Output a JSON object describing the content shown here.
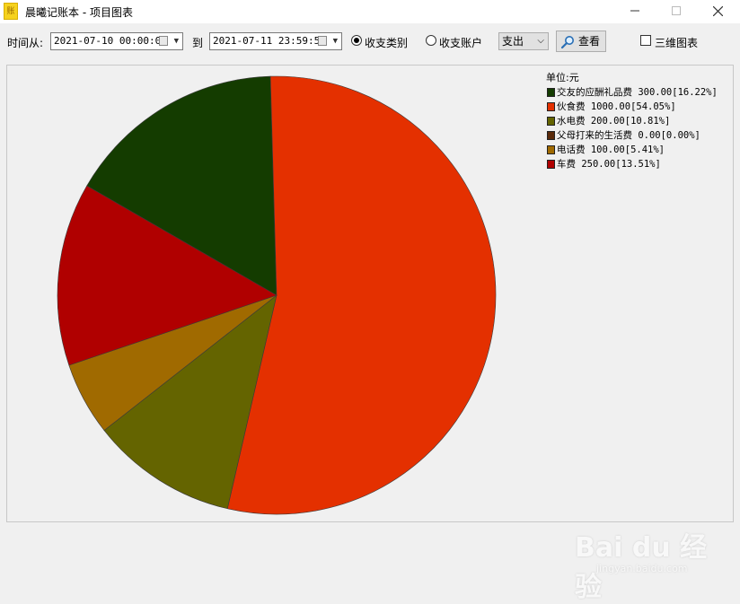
{
  "window": {
    "title": "晨曦记账本 - 项目图表",
    "icon_name": "ledger-app-icon",
    "icon_text": "账"
  },
  "toolbar": {
    "time_from_label": "时间从:",
    "start_datetime": "2021-07-10 00:00:00",
    "to_label": "到",
    "end_datetime": "2021-07-11 23:59:59",
    "radio_category_label": "收支类别",
    "radio_account_label": "收支账户",
    "radio_selected": "category",
    "type_select_value": "支出",
    "view_button_label": "查看",
    "three_d_label": "三维图表",
    "three_d_checked": false
  },
  "watermark": {
    "main": "Bai du 经验",
    "sub": "jingyan.baidu.com"
  },
  "chart_data": {
    "type": "pie",
    "unit_label": "单位:元",
    "start_angle_deg": 150,
    "direction": "clockwise",
    "legend_position": "top-right",
    "slices": [
      {
        "label": "交友的应酬礼品费",
        "value": 300.0,
        "percent": "16.22%",
        "color": "#143c00",
        "text": "交友的应酬礼品费 300.00[16.22%]"
      },
      {
        "label": "伙食费",
        "value": 1000.0,
        "percent": "54.05%",
        "color": "#e43000",
        "text": "伙食费 1000.00[54.05%]"
      },
      {
        "label": "水电费",
        "value": 200.0,
        "percent": "10.81%",
        "color": "#646400",
        "text": "水电费 200.00[10.81%]"
      },
      {
        "label": "父母打来的生活费",
        "value": 0.0,
        "percent": "0.00%",
        "color": "#5a2a0a",
        "text": "父母打来的生活费 0.00[0.00%]"
      },
      {
        "label": "电话费",
        "value": 100.0,
        "percent": "5.41%",
        "color": "#a06a00",
        "text": "电话费 100.00[5.41%]"
      },
      {
        "label": "车费",
        "value": 250.0,
        "percent": "13.51%",
        "color": "#b00000",
        "text": "车费 250.00[13.51%]"
      }
    ]
  }
}
